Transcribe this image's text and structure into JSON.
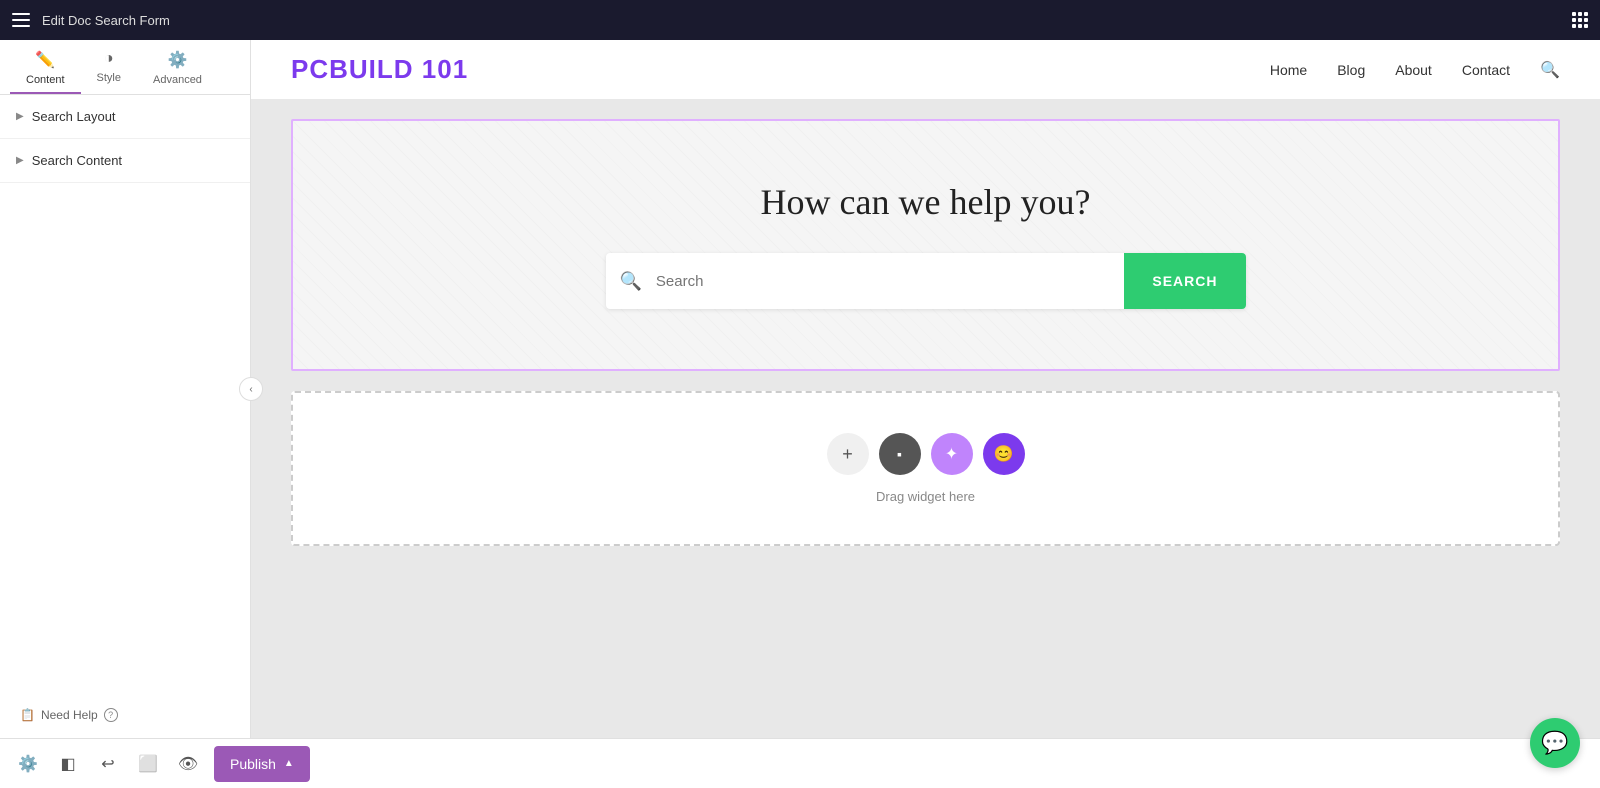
{
  "topbar": {
    "title": "Edit Doc Search Form"
  },
  "sidebar": {
    "tabs": [
      {
        "id": "content",
        "label": "Content",
        "icon": "✏️",
        "active": true
      },
      {
        "id": "style",
        "label": "Style",
        "icon": "◑",
        "active": false
      },
      {
        "id": "advanced",
        "label": "Advanced",
        "icon": "⚙️",
        "active": false
      }
    ],
    "sections": [
      {
        "id": "search-layout",
        "label": "Search Layout"
      },
      {
        "id": "search-content",
        "label": "Search Content"
      }
    ],
    "help": {
      "label": "Need Help"
    }
  },
  "website": {
    "logo": "PCBUILD 101",
    "nav": [
      {
        "label": "Home"
      },
      {
        "label": "Blog"
      },
      {
        "label": "About"
      },
      {
        "label": "Contact"
      }
    ]
  },
  "hero": {
    "title": "How can we help you?",
    "search_placeholder": "Search",
    "search_button": "SEARCH"
  },
  "dropzone": {
    "drag_text": "Drag widget here"
  },
  "bottombar": {
    "publish_label": "Publish"
  },
  "chat": {
    "icon": "💬"
  }
}
